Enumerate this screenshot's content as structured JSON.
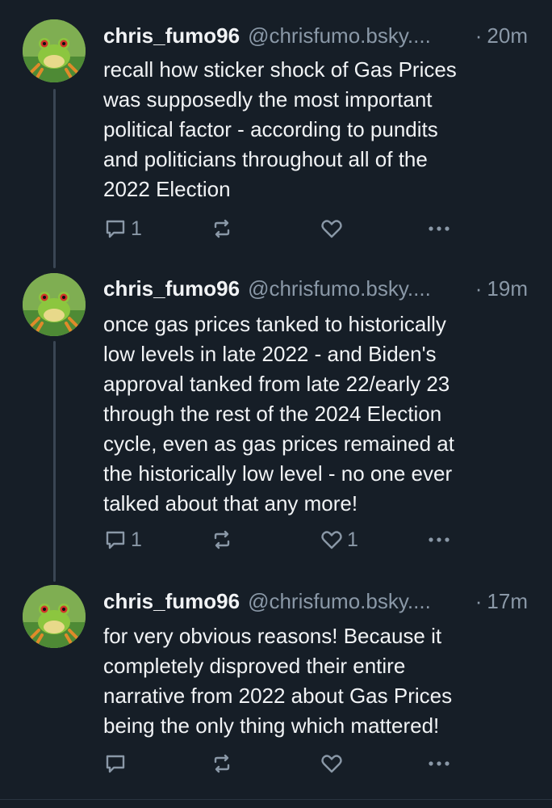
{
  "colors": {
    "background": "#161e27",
    "text_primary": "#f1f3f5",
    "text_secondary": "#8a98a7",
    "thread_line": "#3a4654"
  },
  "posts": [
    {
      "display_name": "chris_fumo96",
      "handle": "@chrisfumo.bsky....",
      "dot": "·",
      "time": "20m",
      "lines": [
        "recall how sticker shock of Gas Prices",
        "was supposedly the most important",
        "political factor - according to pundits",
        "and politicians throughout all of the",
        "2022 Election"
      ],
      "reply_count": "1",
      "repost_count": "",
      "like_count": "",
      "icons": [
        "reply-icon",
        "repost-icon",
        "like-icon",
        "more-icon"
      ]
    },
    {
      "display_name": "chris_fumo96",
      "handle": "@chrisfumo.bsky....",
      "dot": "·",
      "time": "19m",
      "lines": [
        "once gas prices tanked to historically",
        "low levels in late 2022 - and Biden's",
        "approval tanked from late 22/early 23",
        "through the rest of the 2024 Election",
        "cycle, even as gas prices remained at",
        "the historically low level -  no one ever",
        "talked about that any more!"
      ],
      "reply_count": "1",
      "repost_count": "",
      "like_count": "1",
      "icons": [
        "reply-icon",
        "repost-icon",
        "like-icon",
        "more-icon"
      ]
    },
    {
      "display_name": "chris_fumo96",
      "handle": "@chrisfumo.bsky....",
      "dot": "·",
      "time": "17m",
      "lines": [
        "for very obvious reasons! Because it",
        "completely disproved their entire",
        "narrative from 2022 about Gas Prices",
        "being the only thing which mattered!"
      ],
      "reply_count": "",
      "repost_count": "",
      "like_count": "",
      "icons": [
        "reply-icon",
        "repost-icon",
        "like-icon",
        "more-icon"
      ]
    }
  ]
}
